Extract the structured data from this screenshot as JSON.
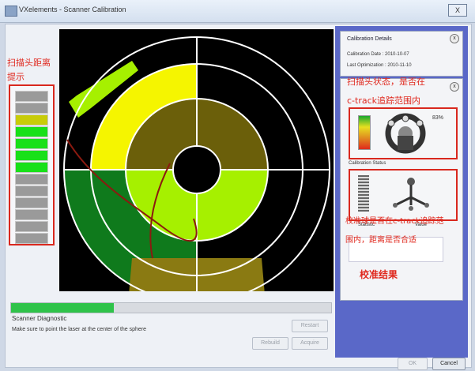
{
  "window": {
    "title": "VXelements - Scanner Calibration",
    "close_label": "X"
  },
  "canvas": {
    "colors": {
      "background": "#000000",
      "ring_line": "#ffffff",
      "yellow": "#f5f500",
      "olive": "#6b5f0a",
      "olive_light": "#8a7a12",
      "lime": "#a6f000",
      "dark_green": "#0f7a1c",
      "green_mid": "#2eab1f",
      "dark_red_curve": "#8b1a10"
    }
  },
  "left_indicator": {
    "segments": [
      "#9a9a9a",
      "#9a9a9a",
      "#c8cc08",
      "#19e019",
      "#19e019",
      "#19e019",
      "#19e019",
      "#9a9a9a",
      "#9a9a9a",
      "#9a9a9a",
      "#9a9a9a",
      "#9a9a9a",
      "#9a9a9a"
    ]
  },
  "annotations": {
    "distance_hint_line1": "扫描头距离",
    "distance_hint_line2": "提示",
    "scanner_state_line1": "扫描头状态，是否在",
    "scanner_state_line2": "c-track追踪范围内",
    "sphere_line1": "校准球是否在c-track追踪范",
    "sphere_line2": "围内，距离是否合适",
    "result": "校准结果"
  },
  "diagnostic": {
    "progress_fraction": 0.32,
    "label": "Scanner Diagnostic",
    "message": "Make sure to point the laser at the center of the sphere",
    "buttons": {
      "restart": "Restart",
      "rebuild": "Rebuild",
      "acquire": "Acquire"
    }
  },
  "side_panel": {
    "calibration_details": {
      "title": "Calibration Details",
      "close_label": "x",
      "date": "Calibration Date : 2010-10-07",
      "last_optimization": "Last Optimization : 2010-11-10"
    },
    "second_panel_close": "x",
    "tracking_percent": "83%",
    "calibration_status_label": "Calibration Status",
    "table_headers": {
      "statistic": "Statistic",
      "value": "Value"
    }
  },
  "footer": {
    "ok": "OK",
    "cancel": "Cancel"
  }
}
